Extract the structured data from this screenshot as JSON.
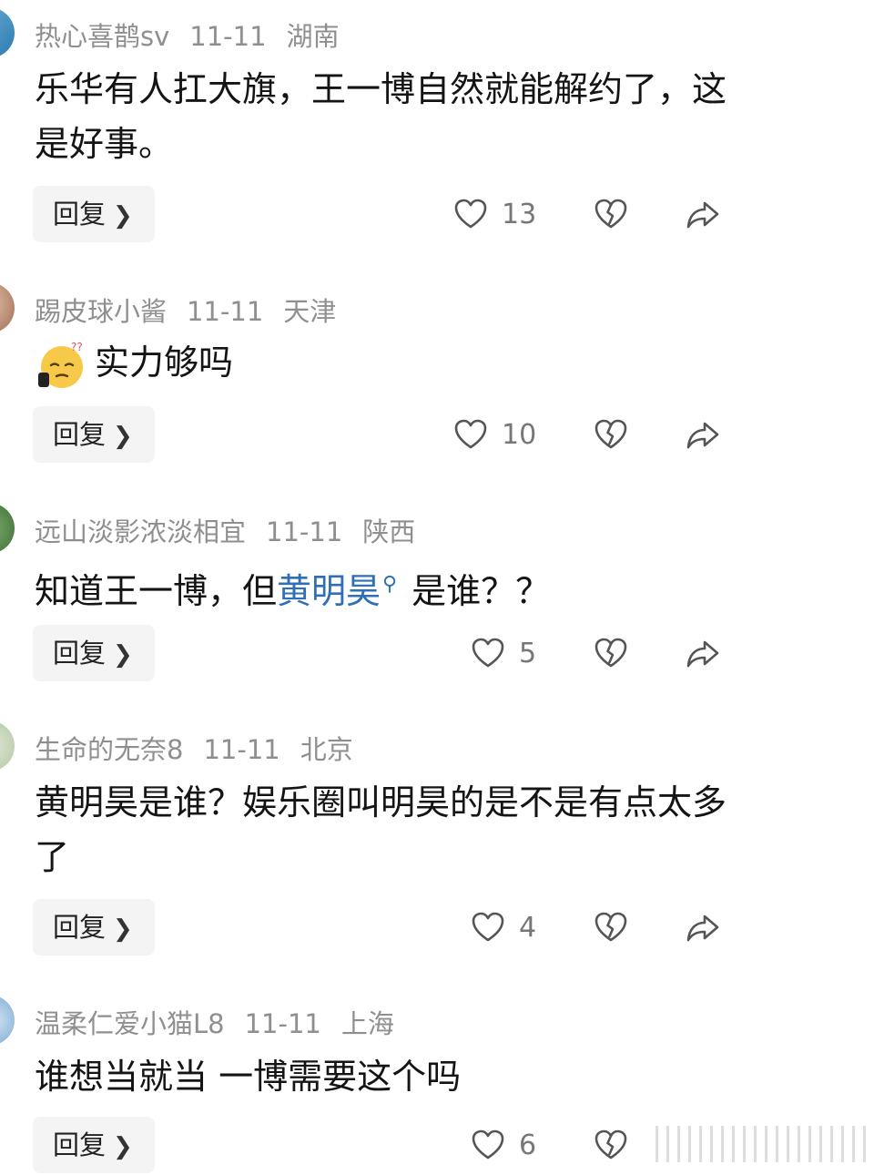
{
  "reply_label": "回复",
  "comments": [
    {
      "username": "热心喜鹊sv",
      "date": "11-11",
      "location": "湖南",
      "text": "乐华有人扛大旗，王一博自然就能解约了，这是好事。",
      "likes": "13"
    },
    {
      "username": "踢皮球小酱",
      "date": "11-11",
      "location": "天津",
      "sticker": "thinking-sweat-emoji",
      "text": "实力够吗",
      "likes": "10"
    },
    {
      "username": "远山淡影浓淡相宜",
      "date": "11-11",
      "location": "陕西",
      "text_before": "知道王一博，但",
      "link": "黄明昊",
      "text_after": "是谁？？",
      "likes": "5"
    },
    {
      "username": "生命的无奈8",
      "date": "11-11",
      "location": "北京",
      "text": "黄明昊是谁？娱乐圈叫明昊的是不是有点太多了",
      "likes": "4"
    },
    {
      "username": "温柔仁爱小猫L8",
      "date": "11-11",
      "location": "上海",
      "text": "谁想当就当 一博需要这个吗",
      "likes": "6"
    }
  ],
  "icons": {
    "like": "heart-outline-icon",
    "dislike": "broken-heart-icon",
    "share": "share-arrow-icon",
    "reply_chevron": "chevron-right-icon"
  },
  "colors": {
    "meta_text": "#8f8f8f",
    "link": "#2f6fb8",
    "button_bg": "#f4f4f4"
  }
}
